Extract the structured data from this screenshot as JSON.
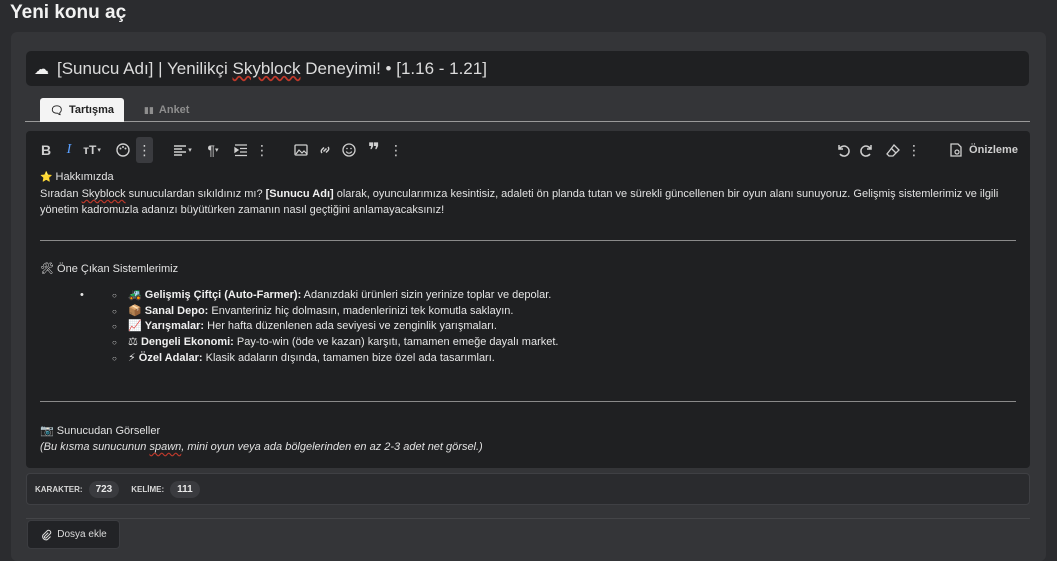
{
  "page": {
    "title": "Yeni konu aç"
  },
  "thread_title": {
    "value": "[Sunucu Adı] | Yenilikçi Skyblock Deneyimi! • [1.16 - 1.21]"
  },
  "tabs": [
    {
      "label": "Tartışma",
      "active": true
    },
    {
      "label": "Anket",
      "active": false
    }
  ],
  "toolbar": {
    "preview_label": "Önizleme"
  },
  "body": {
    "about_heading": "Hakkımızda",
    "about_p1": "Sıradan ",
    "about_skyblock": "Skyblock",
    "about_p2": " sunuculardan sıkıldınız mı? ",
    "about_server": "[Sunucu Adı]",
    "about_p3": " olarak, oyuncularımıza kesintisiz, adaleti ön planda tutan ve sürekli güncellenen bir oyun alanı sunuyoruz. Gelişmiş sistemlerimiz ve ilgili yönetim kadromuzla adanızı büyütürken zamanın nasıl geçtiğini anlamayacaksınız!",
    "features_heading": "Öne Çıkan Sistemlerimiz",
    "features": [
      {
        "emoji": "🚜",
        "title": "Gelişmiş Çiftçi (Auto-Farmer):",
        "text": " Adanızdaki ürünleri sizin yerinize toplar ve depolar."
      },
      {
        "emoji": "📦",
        "title": "Sanal Depo:",
        "text": " Envanteriniz hiç dolmasın, madenlerinizi tek komutla saklayın."
      },
      {
        "emoji": "📈",
        "title": "Yarışmalar:",
        "text": " Her hafta düzenlenen ada seviyesi ve zenginlik yarışmaları."
      },
      {
        "emoji": "⚖",
        "title": "Dengeli Ekonomi:",
        "text": " Pay-to-win (öde ve kazan) karşıtı, tamamen emeğe dayalı market."
      },
      {
        "emoji": "⚡",
        "title": "Özel Adalar:",
        "text": " Klasik adaların dışında, tamamen bize özel ada tasarımları."
      }
    ],
    "images_heading": "Sunucudan Görseller",
    "images_note_1": "(Bu kısma sunucunun ",
    "images_note_spawn": "spawn",
    "images_note_2": ", mini oyun veya ada bölgelerinden en az 2-3 adet net görsel.)"
  },
  "counter": {
    "chars_label": "KARAKTER:",
    "chars_value": "723",
    "words_label": "KELİME:",
    "words_value": "111"
  },
  "attach": {
    "label": "Dosya ekle"
  },
  "icons": {
    "cloud": "☁",
    "star": "⭐",
    "tools": "🛠",
    "camera": "📷"
  }
}
